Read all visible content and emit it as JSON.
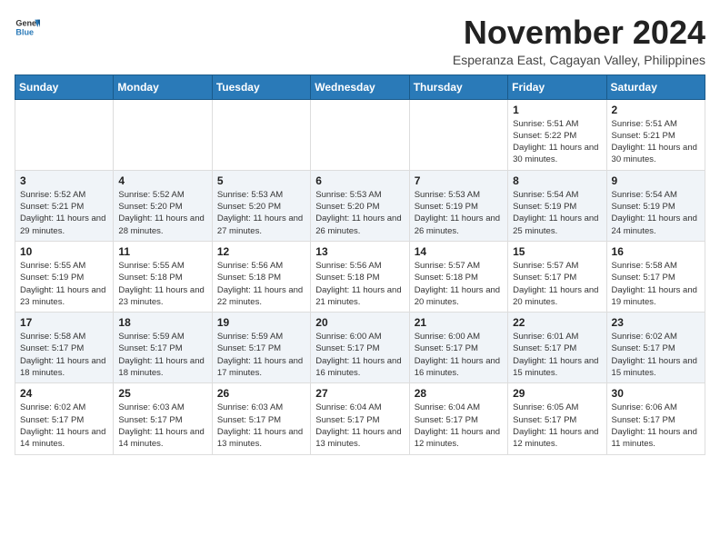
{
  "header": {
    "logo_general": "General",
    "logo_blue": "Blue",
    "title": "November 2024",
    "subtitle": "Esperanza East, Cagayan Valley, Philippines"
  },
  "weekdays": [
    "Sunday",
    "Monday",
    "Tuesday",
    "Wednesday",
    "Thursday",
    "Friday",
    "Saturday"
  ],
  "weeks": [
    [
      {
        "day": "",
        "info": ""
      },
      {
        "day": "",
        "info": ""
      },
      {
        "day": "",
        "info": ""
      },
      {
        "day": "",
        "info": ""
      },
      {
        "day": "",
        "info": ""
      },
      {
        "day": "1",
        "info": "Sunrise: 5:51 AM\nSunset: 5:22 PM\nDaylight: 11 hours and 30 minutes."
      },
      {
        "day": "2",
        "info": "Sunrise: 5:51 AM\nSunset: 5:21 PM\nDaylight: 11 hours and 30 minutes."
      }
    ],
    [
      {
        "day": "3",
        "info": "Sunrise: 5:52 AM\nSunset: 5:21 PM\nDaylight: 11 hours and 29 minutes."
      },
      {
        "day": "4",
        "info": "Sunrise: 5:52 AM\nSunset: 5:20 PM\nDaylight: 11 hours and 28 minutes."
      },
      {
        "day": "5",
        "info": "Sunrise: 5:53 AM\nSunset: 5:20 PM\nDaylight: 11 hours and 27 minutes."
      },
      {
        "day": "6",
        "info": "Sunrise: 5:53 AM\nSunset: 5:20 PM\nDaylight: 11 hours and 26 minutes."
      },
      {
        "day": "7",
        "info": "Sunrise: 5:53 AM\nSunset: 5:19 PM\nDaylight: 11 hours and 26 minutes."
      },
      {
        "day": "8",
        "info": "Sunrise: 5:54 AM\nSunset: 5:19 PM\nDaylight: 11 hours and 25 minutes."
      },
      {
        "day": "9",
        "info": "Sunrise: 5:54 AM\nSunset: 5:19 PM\nDaylight: 11 hours and 24 minutes."
      }
    ],
    [
      {
        "day": "10",
        "info": "Sunrise: 5:55 AM\nSunset: 5:19 PM\nDaylight: 11 hours and 23 minutes."
      },
      {
        "day": "11",
        "info": "Sunrise: 5:55 AM\nSunset: 5:18 PM\nDaylight: 11 hours and 23 minutes."
      },
      {
        "day": "12",
        "info": "Sunrise: 5:56 AM\nSunset: 5:18 PM\nDaylight: 11 hours and 22 minutes."
      },
      {
        "day": "13",
        "info": "Sunrise: 5:56 AM\nSunset: 5:18 PM\nDaylight: 11 hours and 21 minutes."
      },
      {
        "day": "14",
        "info": "Sunrise: 5:57 AM\nSunset: 5:18 PM\nDaylight: 11 hours and 20 minutes."
      },
      {
        "day": "15",
        "info": "Sunrise: 5:57 AM\nSunset: 5:17 PM\nDaylight: 11 hours and 20 minutes."
      },
      {
        "day": "16",
        "info": "Sunrise: 5:58 AM\nSunset: 5:17 PM\nDaylight: 11 hours and 19 minutes."
      }
    ],
    [
      {
        "day": "17",
        "info": "Sunrise: 5:58 AM\nSunset: 5:17 PM\nDaylight: 11 hours and 18 minutes."
      },
      {
        "day": "18",
        "info": "Sunrise: 5:59 AM\nSunset: 5:17 PM\nDaylight: 11 hours and 18 minutes."
      },
      {
        "day": "19",
        "info": "Sunrise: 5:59 AM\nSunset: 5:17 PM\nDaylight: 11 hours and 17 minutes."
      },
      {
        "day": "20",
        "info": "Sunrise: 6:00 AM\nSunset: 5:17 PM\nDaylight: 11 hours and 16 minutes."
      },
      {
        "day": "21",
        "info": "Sunrise: 6:00 AM\nSunset: 5:17 PM\nDaylight: 11 hours and 16 minutes."
      },
      {
        "day": "22",
        "info": "Sunrise: 6:01 AM\nSunset: 5:17 PM\nDaylight: 11 hours and 15 minutes."
      },
      {
        "day": "23",
        "info": "Sunrise: 6:02 AM\nSunset: 5:17 PM\nDaylight: 11 hours and 15 minutes."
      }
    ],
    [
      {
        "day": "24",
        "info": "Sunrise: 6:02 AM\nSunset: 5:17 PM\nDaylight: 11 hours and 14 minutes."
      },
      {
        "day": "25",
        "info": "Sunrise: 6:03 AM\nSunset: 5:17 PM\nDaylight: 11 hours and 14 minutes."
      },
      {
        "day": "26",
        "info": "Sunrise: 6:03 AM\nSunset: 5:17 PM\nDaylight: 11 hours and 13 minutes."
      },
      {
        "day": "27",
        "info": "Sunrise: 6:04 AM\nSunset: 5:17 PM\nDaylight: 11 hours and 13 minutes."
      },
      {
        "day": "28",
        "info": "Sunrise: 6:04 AM\nSunset: 5:17 PM\nDaylight: 11 hours and 12 minutes."
      },
      {
        "day": "29",
        "info": "Sunrise: 6:05 AM\nSunset: 5:17 PM\nDaylight: 11 hours and 12 minutes."
      },
      {
        "day": "30",
        "info": "Sunrise: 6:06 AM\nSunset: 5:17 PM\nDaylight: 11 hours and 11 minutes."
      }
    ]
  ]
}
